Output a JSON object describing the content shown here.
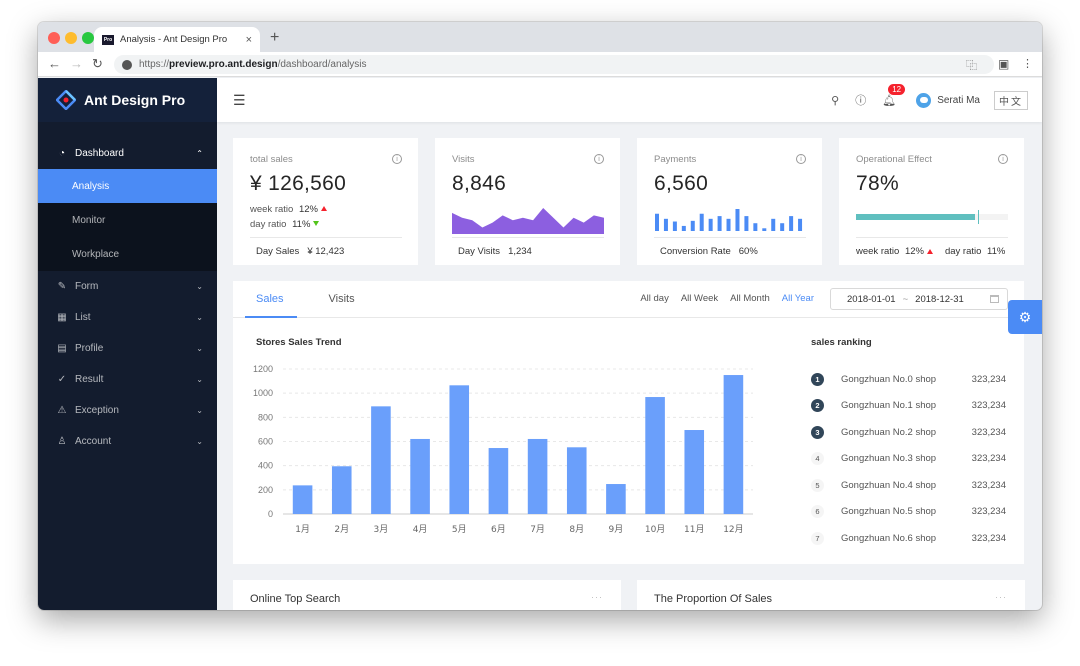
{
  "browser": {
    "tab_title": "Analysis - Ant Design Pro",
    "favicon_text": "Pro",
    "url_scheme": "https://",
    "url_host": "preview.pro.ant.design",
    "url_path": "/dashboard/analysis"
  },
  "sidebar": {
    "brand": "Ant Design Pro",
    "menu": [
      {
        "label": "Dashboard",
        "icon": "dashboard-icon",
        "glyph": "◔",
        "open": true,
        "children": [
          {
            "label": "Analysis",
            "active": true
          },
          {
            "label": "Monitor",
            "active": false
          },
          {
            "label": "Workplace",
            "active": false
          }
        ]
      },
      {
        "label": "Form",
        "icon": "form-icon",
        "glyph": "✎"
      },
      {
        "label": "List",
        "icon": "table-icon",
        "glyph": "▦"
      },
      {
        "label": "Profile",
        "icon": "profile-icon",
        "glyph": "▤"
      },
      {
        "label": "Result",
        "icon": "check-circle-icon",
        "glyph": "✓"
      },
      {
        "label": "Exception",
        "icon": "warning-icon",
        "glyph": "⚠"
      },
      {
        "label": "Account",
        "icon": "user-icon",
        "glyph": "♙"
      }
    ]
  },
  "header": {
    "notification_count": "12",
    "username": "Serati Ma",
    "language": "中文"
  },
  "stats": [
    {
      "title": "total sales",
      "value": "¥ 126,560",
      "week_ratio_label": "week ratio",
      "week_ratio": "12%",
      "day_ratio_label": "day ratio",
      "day_ratio": "11%",
      "footer_label": "Day Sales",
      "footer_value": "¥ 12,423"
    },
    {
      "title": "Visits",
      "value": "8,846",
      "footer_label": "Day Visits",
      "footer_value": "1,234",
      "area_values": [
        7,
        5,
        4,
        1,
        3,
        6,
        4,
        5,
        4,
        9,
        5,
        1,
        5,
        3,
        6,
        5
      ]
    },
    {
      "title": "Payments",
      "value": "6,560",
      "footer_label": "Conversion Rate",
      "footer_value": "60%",
      "bar_values": [
        51,
        36,
        28,
        15,
        30,
        51,
        36,
        44,
        36,
        65,
        44,
        23,
        8,
        36,
        23,
        44,
        36
      ]
    },
    {
      "title": "Operational Effect",
      "value": "78%",
      "progress_percent": 78,
      "target_percent": 80,
      "week_ratio_label": "week ratio",
      "week_ratio": "12%",
      "day_ratio_label": "day ratio",
      "day_ratio": "11%"
    }
  ],
  "sales_card": {
    "tabs": [
      "Sales",
      "Visits"
    ],
    "range_links": [
      "All day",
      "All Week",
      "All Month",
      "All Year"
    ],
    "active_range": "All Year",
    "date_start": "2018-01-01",
    "date_sep": "~",
    "date_end": "2018-12-31",
    "ranking_title": "sales ranking",
    "ranking": [
      {
        "rank": "1",
        "name": "Gongzhuan No.0 shop",
        "value": "323,234"
      },
      {
        "rank": "2",
        "name": "Gongzhuan No.1 shop",
        "value": "323,234"
      },
      {
        "rank": "3",
        "name": "Gongzhuan No.2 shop",
        "value": "323,234"
      },
      {
        "rank": "4",
        "name": "Gongzhuan No.3 shop",
        "value": "323,234"
      },
      {
        "rank": "5",
        "name": "Gongzhuan No.4 shop",
        "value": "323,234"
      },
      {
        "rank": "6",
        "name": "Gongzhuan No.5 shop",
        "value": "323,234"
      },
      {
        "rank": "7",
        "name": "Gongzhuan No.6 shop",
        "value": "323,234"
      }
    ]
  },
  "chart_data": {
    "type": "bar",
    "title": "Stores Sales Trend",
    "categories": [
      "1月",
      "2月",
      "3月",
      "4月",
      "5月",
      "6月",
      "7月",
      "8月",
      "9月",
      "10月",
      "11月",
      "12月"
    ],
    "values": [
      237,
      395,
      891,
      621,
      1065,
      546,
      621,
      552,
      248,
      968,
      695,
      1150
    ],
    "xlabel": "",
    "ylabel": "",
    "ylim": [
      0,
      1200
    ],
    "yticks": [
      0,
      200,
      400,
      600,
      800,
      1000,
      1200
    ],
    "grid": true,
    "color": "#6a9ffb"
  },
  "bottom_cards": [
    {
      "title": "Online Top Search"
    },
    {
      "title": "The Proportion Of Sales"
    }
  ],
  "colors": {
    "accent": "#4b8bf5",
    "visits_area": "#8c5fe0",
    "payments_bars": "#4b8bf5",
    "progress": "#5fbfbf",
    "up": "#f5222d",
    "down": "#52c41a"
  }
}
